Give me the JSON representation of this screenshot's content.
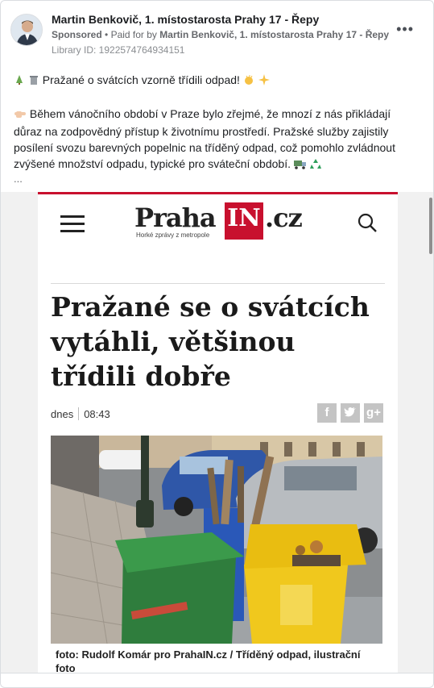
{
  "advertiser": {
    "name": "Martin Benkovič, 1. místostarosta Prahy 17 - Řepy",
    "sponsored_label": "Sponsored",
    "paid_for_prefix": "Paid for by",
    "payer": "Martin Benkovič, 1. místostarosta Prahy 17 - Řepy",
    "library_id": "Library ID: 1922574764934151",
    "more_icon": "more-options-icon"
  },
  "post": {
    "line1": "Pražané o svátcích vzorně třídili odpad!",
    "line2": "Během vánočního období v Praze bylo zřejmé, že mnozí z nás přikládají důraz na zodpovědný přístup k životnímu prostředí. Pražské služby zajistily posílení svozu barevných popelnic na tříděný odpad, což pomohlo zvládnout zvýšené množství odpadu, typické pro sváteční období.",
    "ellipsis": "...",
    "icons": [
      "tree-icon",
      "trash-bin-icon",
      "clapping-hands-icon",
      "sparkles-icon",
      "pointing-hand-icon",
      "truck-icon",
      "recycle-icon"
    ]
  },
  "creative": {
    "logo_praha": "Praha",
    "logo_in": "IN",
    "logo_cz": ".cz",
    "logo_tagline": "Horké zprávy z metropole",
    "headline": "Pražané se o svátcích vytáhli, většinou třídili dobře",
    "date": "dnes",
    "time": "08:43",
    "share_facebook": "f",
    "share_twitter": "t",
    "share_google": "g+",
    "caption": "foto: Rudolf Komár pro PrahaIN.cz / Tříděný odpad, ilustrační foto",
    "accent_color": "#c8102e"
  }
}
